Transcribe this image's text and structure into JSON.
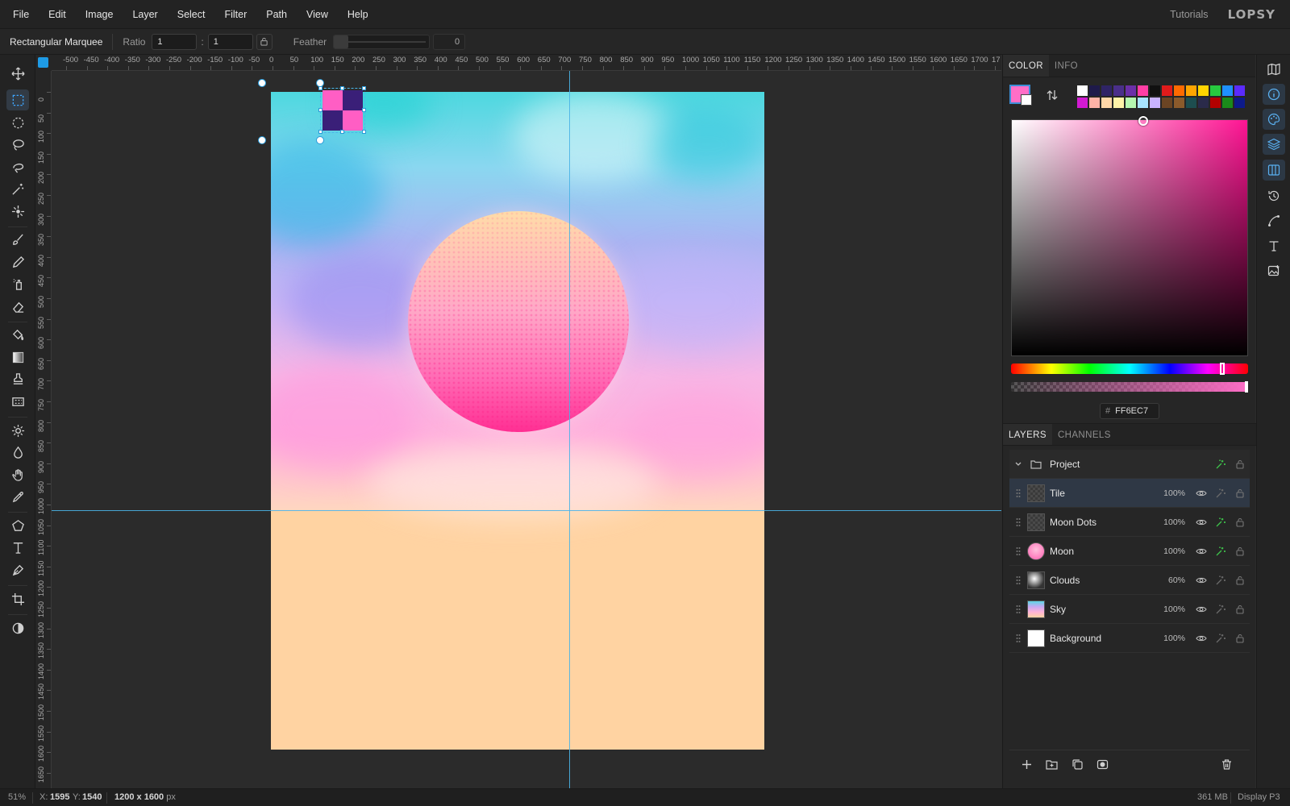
{
  "menu": [
    "File",
    "Edit",
    "Image",
    "Layer",
    "Select",
    "Filter",
    "Path",
    "View",
    "Help"
  ],
  "header": {
    "tutorials": "Tutorials",
    "logo": "LOPSY"
  },
  "options": {
    "tool_name": "Rectangular Marquee",
    "ratio_label": "Ratio",
    "ratio_w": "1",
    "ratio_sep": ":",
    "ratio_h": "1",
    "feather_label": "Feather",
    "feather_value": "0"
  },
  "tools": [
    "move-icon",
    "rectangle-select-icon",
    "ellipse-select-icon",
    "lasso-icon",
    "magnetic-lasso-icon",
    "magic-wand-icon",
    "quick-select-icon",
    "brush-icon",
    "pencil-icon",
    "spray-icon",
    "eraser-icon",
    "bucket-fill-icon",
    "gradient-icon",
    "stamp-icon",
    "pattern-icon",
    "dodge-icon",
    "blur-icon",
    "hand-icon",
    "eyedropper-icon",
    "polygon-icon",
    "text-icon",
    "pen-icon",
    "crop-icon",
    "contrast-icon"
  ],
  "active_tool": "rectangle-select-icon",
  "ruler": {
    "top_labels": [
      "-500",
      "-450",
      "-400",
      "-350",
      "-300",
      "-250",
      "-200",
      "-150",
      "-100",
      "-50",
      "0",
      "50",
      "100",
      "150",
      "200",
      "250",
      "300",
      "350",
      "400",
      "450",
      "500",
      "550",
      "600",
      "650",
      "700",
      "750",
      "800",
      "850",
      "900",
      "950",
      "1000",
      "1050",
      "1100",
      "1150",
      "1200",
      "1250",
      "1300",
      "1350",
      "1400",
      "1450",
      "1500",
      "1550",
      "1600",
      "1650",
      "1700",
      "17"
    ],
    "left_labels": [
      "0",
      "50",
      "100",
      "150",
      "200",
      "250",
      "300",
      "350",
      "400",
      "450",
      "500",
      "550",
      "600",
      "650",
      "700",
      "750",
      "800",
      "850",
      "900",
      "950",
      "1000",
      "1050",
      "1100",
      "1150",
      "1200",
      "1250",
      "1300",
      "1350",
      "1400",
      "1450",
      "1500",
      "1550",
      "1600",
      "1650"
    ]
  },
  "color_panel": {
    "tabs": [
      "COLOR",
      "INFO"
    ],
    "active_tab": "COLOR",
    "foreground": "#FF6EC7",
    "background": "#FFFFFF",
    "hex_label": "#",
    "hex_value": "FF6EC7",
    "hue_position_pct": 90,
    "palette": [
      "#ffffff",
      "#1e1a4a",
      "#2f2466",
      "#4a2f8a",
      "#6b2fa8",
      "#ff3ea5",
      "#111111",
      "#e01b1b",
      "#ff6a00",
      "#ffa500",
      "#ffd400",
      "#27c93f",
      "#1e90ff",
      "#5b2bff",
      "#d21ad2",
      "#ffb3a7",
      "#ffd7a8",
      "#fff2a8",
      "#b6f7b0",
      "#a8e4ff",
      "#c9b3ff",
      "#6b4423",
      "#8b5a2b",
      "#1d4d4f",
      "#2a2a4a",
      "#b30000",
      "#1a8a1a",
      "#0d1a8a"
    ]
  },
  "layers_panel": {
    "tabs": [
      "LAYERS",
      "CHANNELS"
    ],
    "active_tab": "LAYERS",
    "group": "Project",
    "layers": [
      {
        "name": "Tile",
        "opacity": "100%",
        "selected": true,
        "fx": false
      },
      {
        "name": "Moon Dots",
        "opacity": "100%",
        "selected": false,
        "fx": true
      },
      {
        "name": "Moon",
        "opacity": "100%",
        "selected": false,
        "fx": true
      },
      {
        "name": "Clouds",
        "opacity": "60%",
        "selected": false,
        "fx": false
      },
      {
        "name": "Sky",
        "opacity": "100%",
        "selected": false,
        "fx": false
      },
      {
        "name": "Background",
        "opacity": "100%",
        "selected": false,
        "fx": false
      }
    ],
    "actions": [
      "add-layer-icon",
      "new-group-icon",
      "duplicate-layer-icon",
      "mask-icon",
      "delete-layer-icon"
    ]
  },
  "right_strip": [
    "map-icon",
    "info-icon",
    "palette-icon",
    "layers-icon",
    "channels-icon",
    "history-icon",
    "path-icon",
    "type-icon",
    "image-icon"
  ],
  "status": {
    "zoom": "51%",
    "x_label": "X:",
    "x": "1595",
    "y_label": "Y:",
    "y": "1540",
    "doc_size": "1200 x 1600",
    "doc_unit": "px",
    "memory": "361 MB",
    "color_profile": "Display P3"
  },
  "canvas_colors": {
    "tile": [
      "#ff5ec4",
      "#3a1f78",
      "#3a1f78",
      "#ff5ec4"
    ],
    "background": "#ffd3a2"
  }
}
